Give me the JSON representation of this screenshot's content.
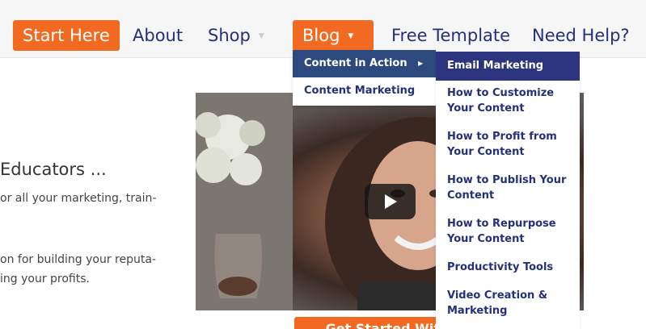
{
  "nav": {
    "start_here": "Start Here",
    "about": "About",
    "shop": "Shop",
    "blog": "Blog",
    "free_template": "Free Template",
    "need_help": "Need Help?",
    "caret": "▼"
  },
  "hero": {
    "heading": "Educators ...",
    "line1": "or all your marketing, train-",
    "line2": "on for building your reputa-",
    "line3": "ing your profits."
  },
  "blog_menu": {
    "items": [
      {
        "label": "Content in Action",
        "caret": "▶"
      },
      {
        "label": "Content Marketing"
      }
    ]
  },
  "submenu": {
    "items": [
      {
        "label": "Email Marketing"
      },
      {
        "label": "How to Customize Your Content"
      },
      {
        "label": "How to Profit from Your Content"
      },
      {
        "label": "How to Publish Your Content"
      },
      {
        "label": "How to Repurpose Your Content"
      },
      {
        "label": "Productivity Tools"
      },
      {
        "label": "Video Creation & Marketing"
      }
    ]
  },
  "cta": {
    "label": "Get Started With Your Free"
  },
  "colors": {
    "accent_orange": "#f26a22",
    "nav_text": "#23307a",
    "menu_active": "#2d4a7e"
  }
}
